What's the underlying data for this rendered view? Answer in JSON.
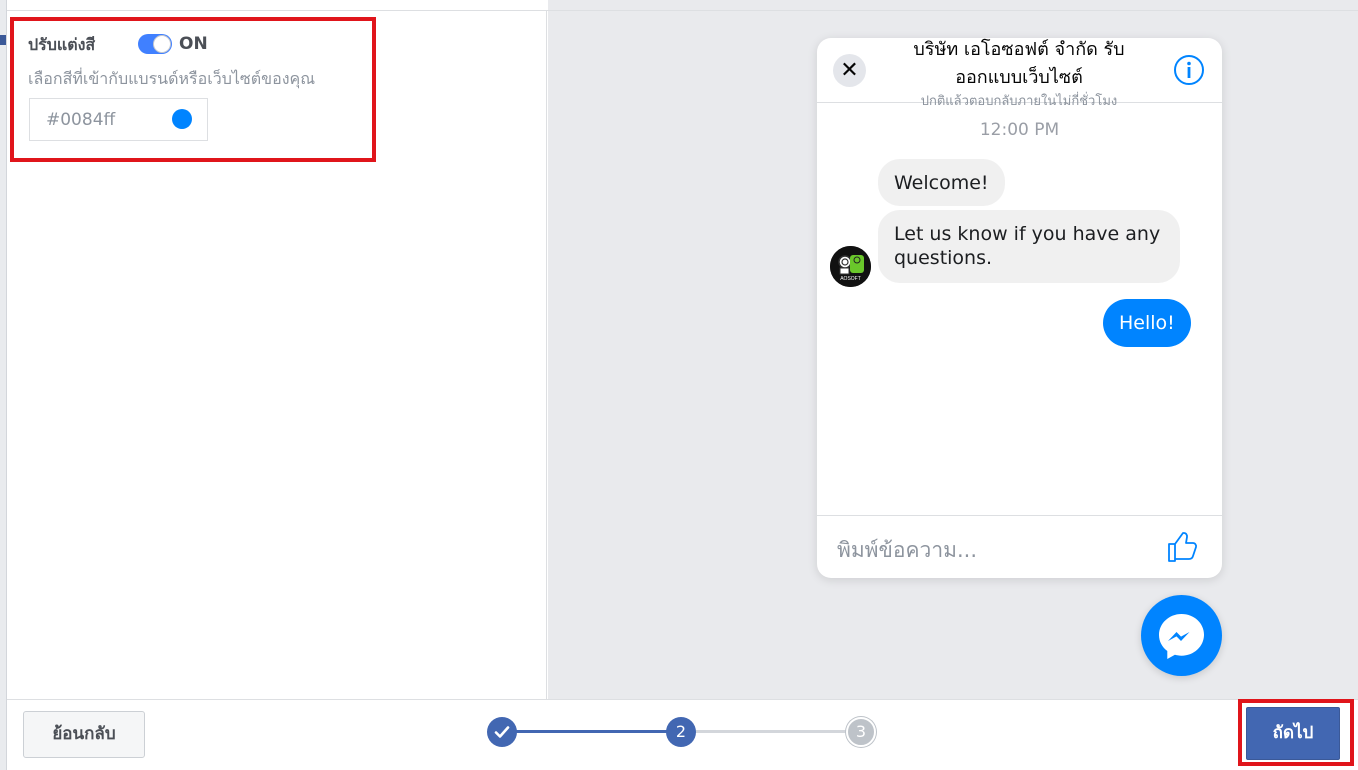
{
  "color_settings": {
    "title": "ปรับแต่งสี",
    "toggle_state": "ON",
    "subtitle": "เลือกสีที่เข้ากับแบรนด์หรือเว็บไซต์ของคุณ",
    "color_value": "#0084ff"
  },
  "chat_preview": {
    "page_name": "บริษัท เอโอซอฟต์ จำกัด รับออกแบบเว็บไซต์",
    "reply_note": "ปกติแล้วตอบกลับภายในไม่กี่ชั่วโมง",
    "time": "12:00 PM",
    "messages": [
      {
        "from": "page",
        "text": "Welcome!"
      },
      {
        "from": "page",
        "text": "Let us know if you have any questions."
      },
      {
        "from": "user",
        "text": "Hello!"
      }
    ],
    "composer_placeholder": "พิมพ์ข้อความ...",
    "avatar_label": "AOSOFT"
  },
  "footer": {
    "back_label": "ย้อนกลับ",
    "next_label": "ถัดไป",
    "steps": [
      "1",
      "2",
      "3"
    ],
    "current_step": 2
  },
  "colors": {
    "accent": "#0084ff",
    "fb_blue": "#4267b2",
    "highlight": "#e0151b"
  }
}
